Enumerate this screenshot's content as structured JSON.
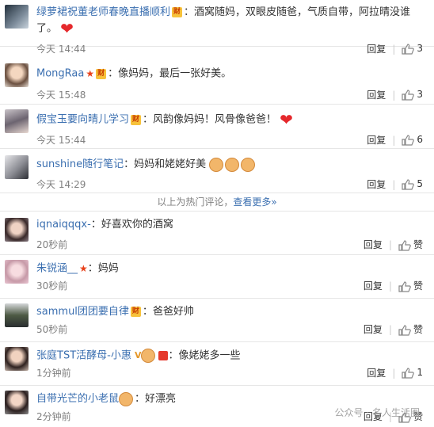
{
  "hot_comments": [
    {
      "user": "绿萝裙祝董老师春晚直播顺利",
      "text": "：酒窝随妈，双眼皮随爸，气质自带，阿拉晴没谁了。",
      "time": "今天 14:44",
      "reply": "回复",
      "likes": "3"
    },
    {
      "user": "MongRaa",
      "text": "：像妈妈，最后一张好美。",
      "time": "今天 15:48",
      "reply": "回复",
      "likes": "3"
    },
    {
      "user": "假宝玉要向晴儿学习",
      "text": "：风韵像妈妈！风骨像爸爸！",
      "time": "今天 15:44",
      "reply": "回复",
      "likes": "6"
    },
    {
      "user": "sunshine随行笔记",
      "text": "：妈妈和姥姥好美",
      "time": "今天 14:29",
      "reply": "回复",
      "likes": "5"
    }
  ],
  "hot_footer": {
    "text": "以上为热门评论，",
    "link": "查看更多»"
  },
  "latest_comments": [
    {
      "user": "iqnaiqqqx-",
      "text": "：好喜欢你的酒窝",
      "time": "20秒前",
      "reply": "回复",
      "likes": "赞"
    },
    {
      "user": "朱锐涵__",
      "text": "：妈妈",
      "time": "30秒前",
      "reply": "回复",
      "likes": "赞"
    },
    {
      "user": "sammul团团要自律",
      "text": "：爸爸好帅",
      "time": "50秒前",
      "reply": "回复",
      "likes": "赞"
    },
    {
      "user": "张庭TST活酵母-小惠",
      "text": "：像姥姥多一些",
      "time": "1分钟前",
      "reply": "回复",
      "likes": "1"
    },
    {
      "user": "自带光芒的小老鼠",
      "text": "：好漂亮",
      "time": "2分钟前",
      "reply": "回复",
      "likes": "赞"
    }
  ],
  "badge_text": "财",
  "watermark": "公众号 · 名人生活圈",
  "colors": {
    "link": "#3b6fb0",
    "muted": "#808080",
    "heart": "#e5282c",
    "badge": "#f7c23b"
  }
}
